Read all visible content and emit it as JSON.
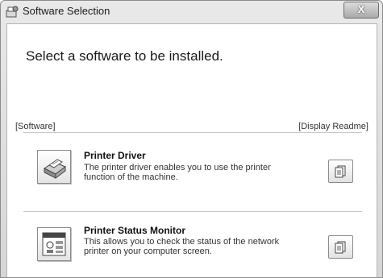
{
  "window": {
    "title": "Software Selection",
    "close_label": "X"
  },
  "heading": "Select a software to be installed.",
  "columns": {
    "software": "[Software]",
    "readme": "[Display Readme]"
  },
  "items": [
    {
      "title": "Printer Driver",
      "description": "The printer driver enables you to use the printer function of the machine.",
      "icon": "printer-icon",
      "readme_icon": "document-icon"
    },
    {
      "title": "Printer Status Monitor",
      "description": "This allows you to check the status of the network printer on your computer screen.",
      "icon": "status-monitor-icon",
      "readme_icon": "document-icon"
    }
  ]
}
